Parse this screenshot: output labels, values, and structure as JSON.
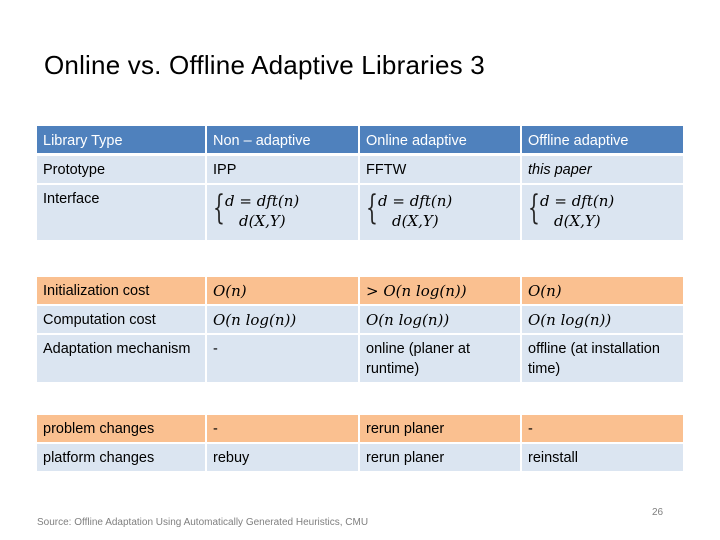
{
  "slide": {
    "title": "Online vs. Offline Adaptive Libraries 3",
    "source": "Source: Offline Adaptation Using Automatically Generated Heuristics, CMU",
    "page_number": "26"
  },
  "table": {
    "header": [
      "Library Type",
      "Non – adaptive",
      "Online adaptive",
      "Offline adaptive"
    ],
    "prototype": {
      "label": "Prototype",
      "values": [
        "IPP",
        "FFTW",
        "this paper"
      ]
    },
    "interface": {
      "label": "Interface",
      "line1": "d = dft(n)",
      "line2": "d(X,Y)"
    },
    "initialization": {
      "label": "Initialization cost",
      "values": [
        "O(n)",
        "> O(n log(n))",
        "O(n)"
      ]
    },
    "computation": {
      "label": "Computation cost",
      "values": [
        "O(n log(n))",
        "O(n log(n))",
        "O(n log(n))"
      ]
    },
    "adaptation": {
      "label": "Adaptation mechanism",
      "values": [
        "-",
        "online (planer at runtime)",
        "offline (at installation time)"
      ]
    },
    "problem_changes": {
      "label": "problem changes",
      "values": [
        "-",
        "rerun planer",
        "-"
      ]
    },
    "platform_changes": {
      "label": "platform changes",
      "values": [
        "rebuy",
        "rerun planer",
        "reinstall"
      ]
    }
  },
  "colors": {
    "header_bg": "#4f81bd",
    "row_light": "#dbe5f1",
    "row_orange": "#fac090"
  }
}
